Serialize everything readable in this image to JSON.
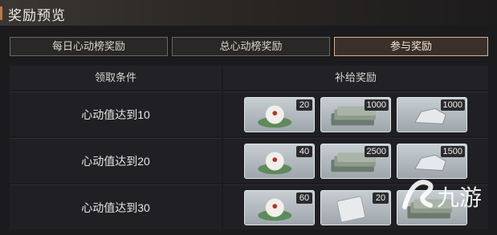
{
  "window": {
    "title": "奖励预览"
  },
  "tabs": [
    {
      "label": "每日心动榜奖励",
      "active": false
    },
    {
      "label": "总心动榜奖励",
      "active": false
    },
    {
      "label": "参与奖励",
      "active": true
    }
  ],
  "table": {
    "headers": {
      "condition": "领取条件",
      "rewards": "补给奖励"
    },
    "rows": [
      {
        "condition": "心动值达到10",
        "rewards": [
          {
            "icon": "bun-on-leaf-icon",
            "qty": "20"
          },
          {
            "icon": "cash-stack-icon",
            "qty": "1000"
          },
          {
            "icon": "silver-pile-icon",
            "qty": "1000"
          }
        ]
      },
      {
        "condition": "心动值达到20",
        "rewards": [
          {
            "icon": "bun-on-leaf-icon",
            "qty": "40"
          },
          {
            "icon": "cash-stack-icon",
            "qty": "2500"
          },
          {
            "icon": "silver-pile-icon",
            "qty": "1500"
          }
        ]
      },
      {
        "condition": "心动值达到30",
        "rewards": [
          {
            "icon": "bun-on-leaf-icon",
            "qty": "60"
          },
          {
            "icon": "packet-icon",
            "qty": "20"
          },
          {
            "icon": "cash-stack-icon",
            "qty": ""
          }
        ]
      }
    ]
  },
  "watermark": {
    "text": "九游",
    "logo": "jiuyou-logo"
  },
  "colors": {
    "accent": "#b87a4c",
    "active_tab_border": "#d4b392",
    "slot_bg": "#b4bcc1"
  }
}
